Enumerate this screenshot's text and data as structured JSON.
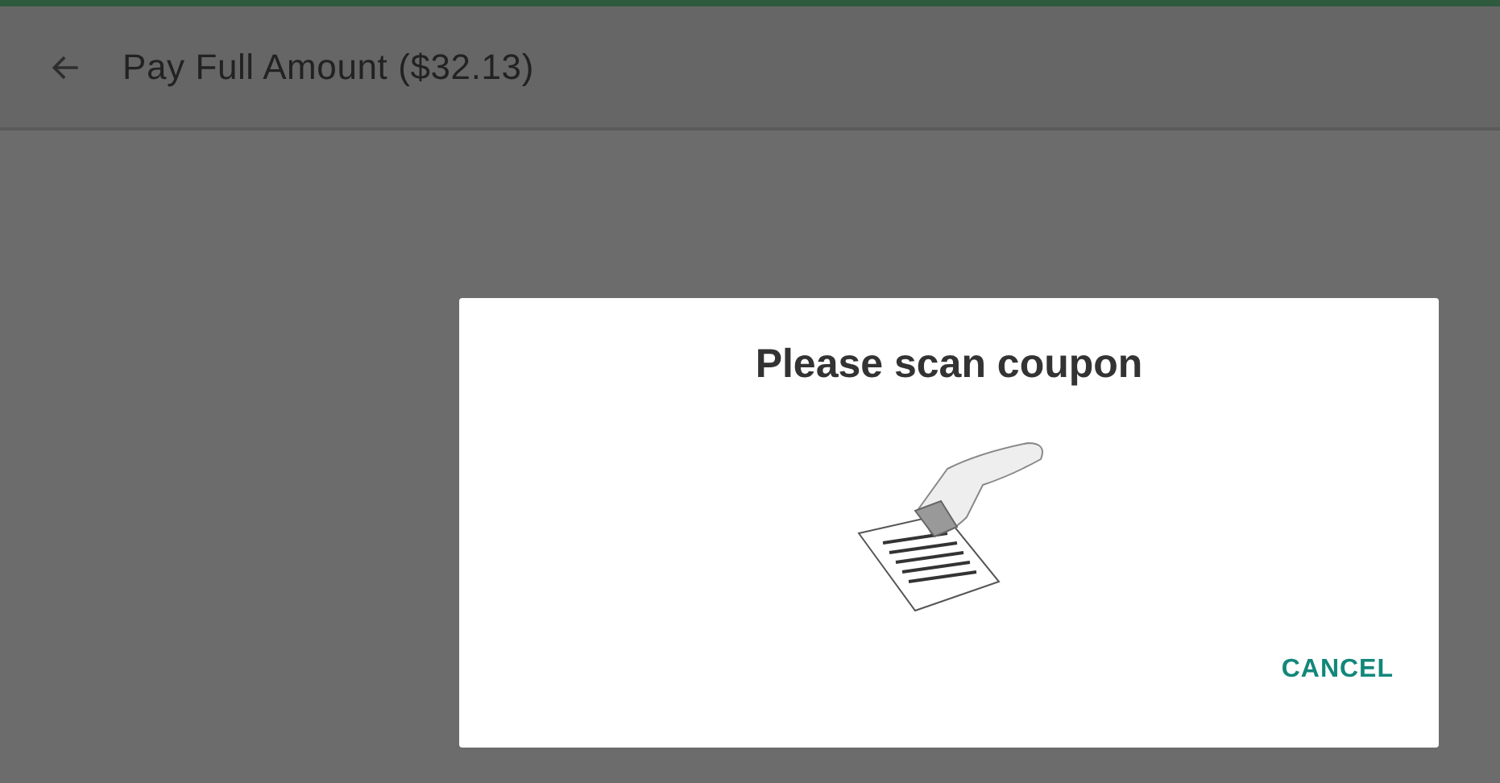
{
  "header": {
    "title": "Pay Full Amount ($32.13)"
  },
  "dialog": {
    "title": "Please scan coupon",
    "buttons": [
      "CANCEL"
    ]
  }
}
